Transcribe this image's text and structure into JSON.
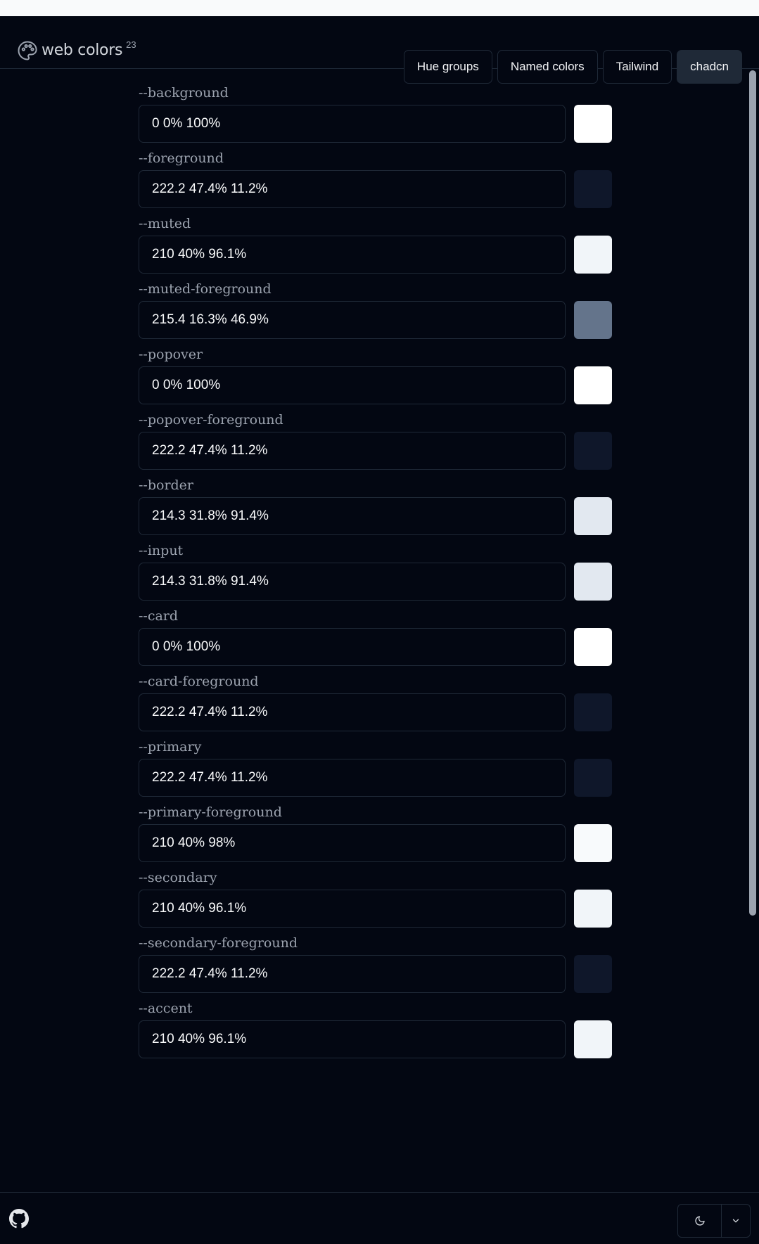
{
  "brand": {
    "name": "web colors",
    "version": "23"
  },
  "nav": [
    {
      "label": "Hue groups",
      "active": false
    },
    {
      "label": "Named colors",
      "active": false
    },
    {
      "label": "Tailwind",
      "active": false
    },
    {
      "label": "chadcn",
      "active": true
    }
  ],
  "variables": [
    {
      "name": "--background",
      "value": "0 0% 100%",
      "color": "#ffffff"
    },
    {
      "name": "--foreground",
      "value": "222.2 47.4% 11.2%",
      "color": "#0f172a"
    },
    {
      "name": "--muted",
      "value": "210 40% 96.1%",
      "color": "#f1f5f9"
    },
    {
      "name": "--muted-foreground",
      "value": "215.4 16.3% 46.9%",
      "color": "#64748b"
    },
    {
      "name": "--popover",
      "value": "0 0% 100%",
      "color": "#ffffff"
    },
    {
      "name": "--popover-foreground",
      "value": "222.2 47.4% 11.2%",
      "color": "#0f172a"
    },
    {
      "name": "--border",
      "value": "214.3 31.8% 91.4%",
      "color": "#e2e8f0"
    },
    {
      "name": "--input",
      "value": "214.3 31.8% 91.4%",
      "color": "#e2e8f0"
    },
    {
      "name": "--card",
      "value": "0 0% 100%",
      "color": "#ffffff"
    },
    {
      "name": "--card-foreground",
      "value": "222.2 47.4% 11.2%",
      "color": "#0f172a"
    },
    {
      "name": "--primary",
      "value": "222.2 47.4% 11.2%",
      "color": "#0f172a"
    },
    {
      "name": "--primary-foreground",
      "value": "210 40% 98%",
      "color": "#f8fafc"
    },
    {
      "name": "--secondary",
      "value": "210 40% 96.1%",
      "color": "#f1f5f9"
    },
    {
      "name": "--secondary-foreground",
      "value": "222.2 47.4% 11.2%",
      "color": "#0f172a"
    },
    {
      "name": "--accent",
      "value": "210 40% 96.1%",
      "color": "#f1f5f9"
    }
  ],
  "footer": {
    "icons": [
      "github-icon",
      "moon-icon",
      "chevron-down-icon"
    ]
  }
}
